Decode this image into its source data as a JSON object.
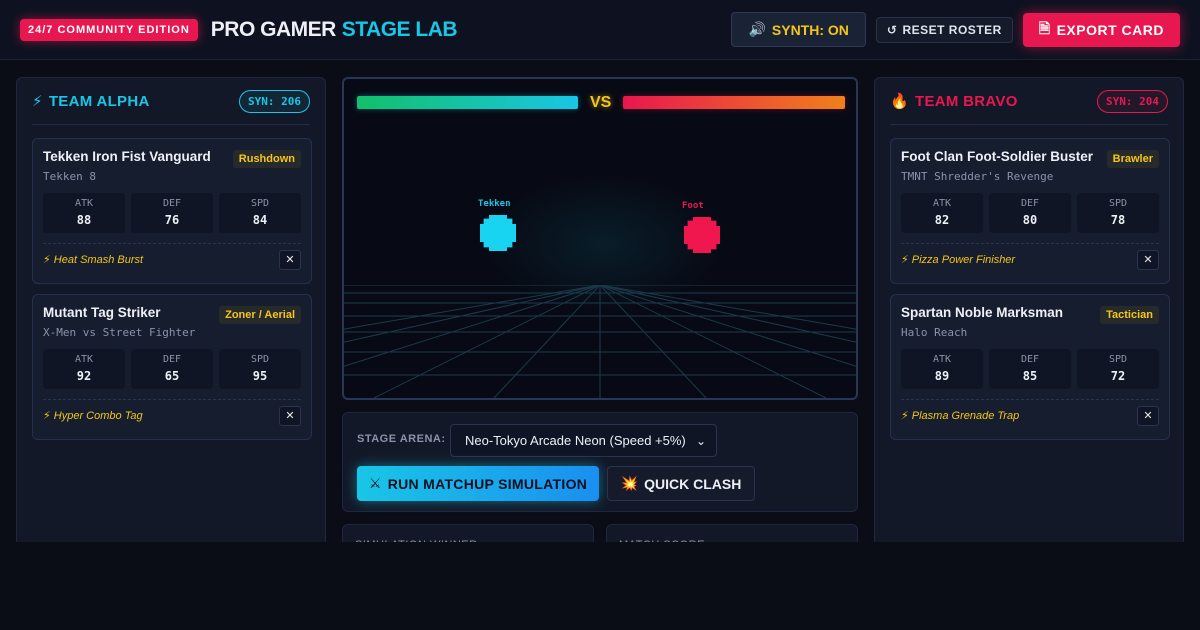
{
  "header": {
    "edition_badge": "24/7 COMMUNITY EDITION",
    "brand_primary": "PRO GAMER",
    "brand_accent": "STAGE LAB",
    "synth_icon": "🔊",
    "synth_label": "SYNTH: ON",
    "reset_icon": "↺",
    "reset_label": "RESET ROSTER",
    "export_icon": "🗎",
    "export_label": "EXPORT CARD"
  },
  "colors": {
    "accent_cyan": "#19c6e6",
    "accent_red": "#e8174f",
    "accent_yellow": "#f5c518",
    "background": "#0a0d16"
  },
  "team_alpha": {
    "icon": "⚡",
    "title": "TEAM ALPHA",
    "synergy": "SYN: 206",
    "fighters": [
      {
        "name": "Tekken Iron Fist Vanguard",
        "role": "Rushdown",
        "game": "Tekken 8",
        "stats": [
          {
            "label": "ATK",
            "value": "88"
          },
          {
            "label": "DEF",
            "value": "76"
          },
          {
            "label": "SPD",
            "value": "84"
          }
        ],
        "move": "⚡ Heat Smash Burst",
        "remove": "✕"
      },
      {
        "name": "Mutant Tag Striker",
        "role": "Zoner / Aerial",
        "game": "X-Men vs Street Fighter",
        "stats": [
          {
            "label": "ATK",
            "value": "92"
          },
          {
            "label": "DEF",
            "value": "65"
          },
          {
            "label": "SPD",
            "value": "95"
          }
        ],
        "move": "⚡ Hyper Combo Tag",
        "remove": "✕"
      }
    ]
  },
  "team_bravo": {
    "icon": "🔥",
    "title": "TEAM BRAVO",
    "synergy": "SYN: 204",
    "fighters": [
      {
        "name": "Foot Clan Foot-Soldier Buster",
        "role": "Brawler",
        "game": "TMNT Shredder's Revenge",
        "stats": [
          {
            "label": "ATK",
            "value": "82"
          },
          {
            "label": "DEF",
            "value": "80"
          },
          {
            "label": "SPD",
            "value": "78"
          }
        ],
        "move": "⚡ Pizza Power Finisher",
        "remove": "✕"
      },
      {
        "name": "Spartan Noble Marksman",
        "role": "Tactician",
        "game": "Halo Reach",
        "stats": [
          {
            "label": "ATK",
            "value": "89"
          },
          {
            "label": "DEF",
            "value": "85"
          },
          {
            "label": "SPD",
            "value": "72"
          }
        ],
        "move": "⚡ Plasma Grenade Trap",
        "remove": "✕"
      }
    ]
  },
  "arena": {
    "vs_label": "VS",
    "alpha_health_fraction": 1.0,
    "bravo_health_fraction": 1.0,
    "alpha_sprite_label": "Tekken",
    "bravo_sprite_label": "Foot"
  },
  "controls": {
    "stage_label": "STAGE ARENA:",
    "stage_selected": "Neo-Tokyo Arcade Neon (Speed +5%)",
    "chevron": "⌄",
    "run_icon": "⚔",
    "run_label": "RUN MATCHUP SIMULATION",
    "clash_icon": "💥",
    "clash_label": "QUICK CLASH"
  },
  "results": {
    "winner_label": "SIMULATION WINNER",
    "score_label": "MATCH SCORE"
  }
}
